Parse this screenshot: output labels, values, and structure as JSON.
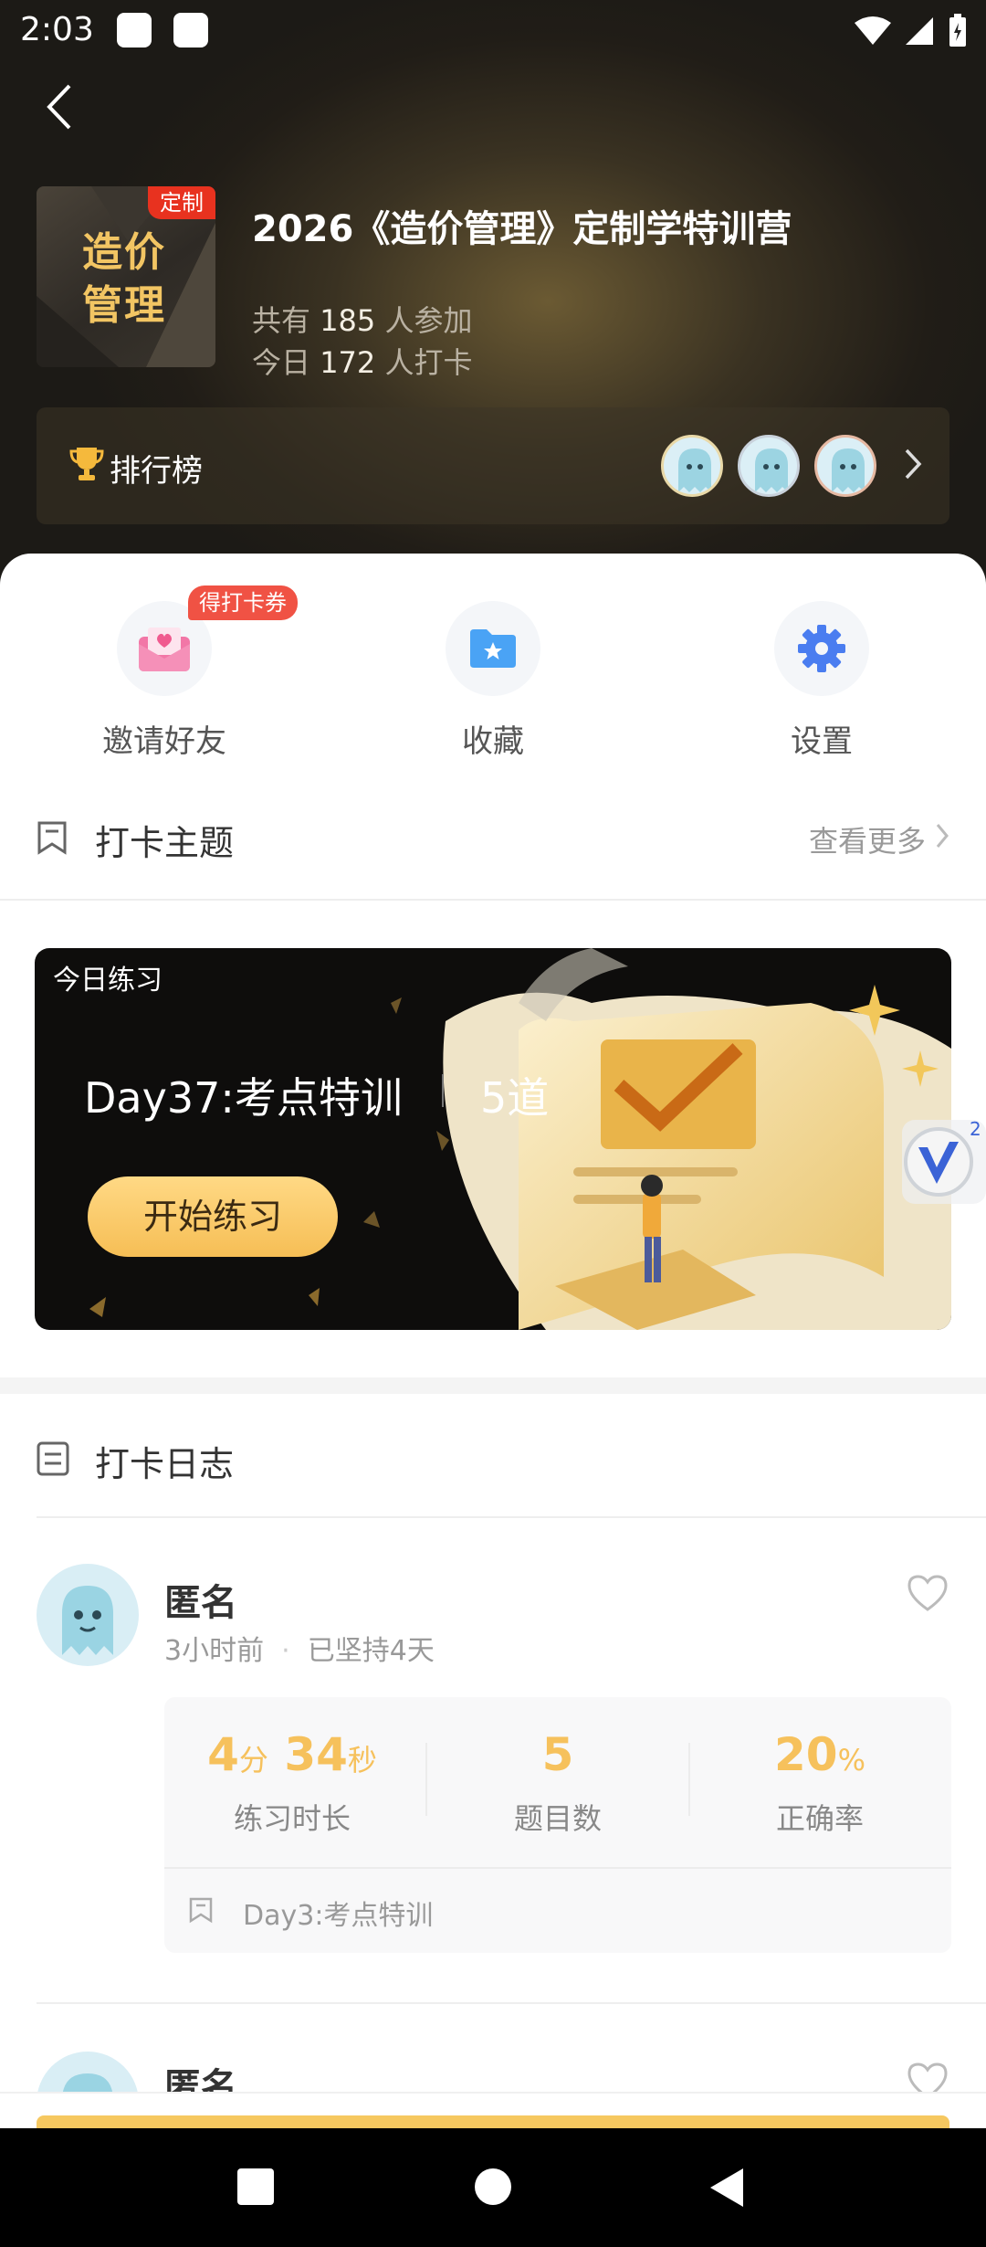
{
  "status_bar": {
    "time": "2:03"
  },
  "course": {
    "cover_text": "造价管理",
    "cover_badge": "定制",
    "title": "2026《造价管理》定制学特训营",
    "participants_prefix": "共有",
    "participants_count": "185",
    "participants_suffix": "人参加",
    "checkin_prefix": "今日",
    "checkin_count": "172",
    "checkin_suffix": "人打卡"
  },
  "leaderboard": {
    "label": "排行榜"
  },
  "quick_actions": [
    {
      "label": "邀请好友",
      "badge": "得打卡券",
      "icon": "envelope-heart-icon"
    },
    {
      "label": "收藏",
      "icon": "folder-star-icon"
    },
    {
      "label": "设置",
      "icon": "gear-icon"
    }
  ],
  "checkin_topic": {
    "title": "打卡主题",
    "more": "查看更多"
  },
  "practice": {
    "tag": "今日练习",
    "title": "Day37:考点特训",
    "count": "5道",
    "button": "开始练习"
  },
  "floating_badge": {
    "count": "2"
  },
  "checkin_log": {
    "title": "打卡日志",
    "entries": [
      {
        "name": "匿名",
        "time": "3小时前",
        "streak": "已坚持4天",
        "duration_min": "4",
        "duration_min_unit": "分",
        "duration_sec": "34",
        "duration_sec_unit": "秒",
        "duration_label": "练习时长",
        "questions": "5",
        "questions_label": "题目数",
        "accuracy": "20",
        "accuracy_unit": "%",
        "accuracy_label": "正确率",
        "topic": "Day3:考点特训"
      },
      {
        "name": "匿名"
      }
    ]
  },
  "colors": {
    "accent_gold": "#f6c15c",
    "badge_red": "#e8321f",
    "header_dark": "#211d17"
  }
}
